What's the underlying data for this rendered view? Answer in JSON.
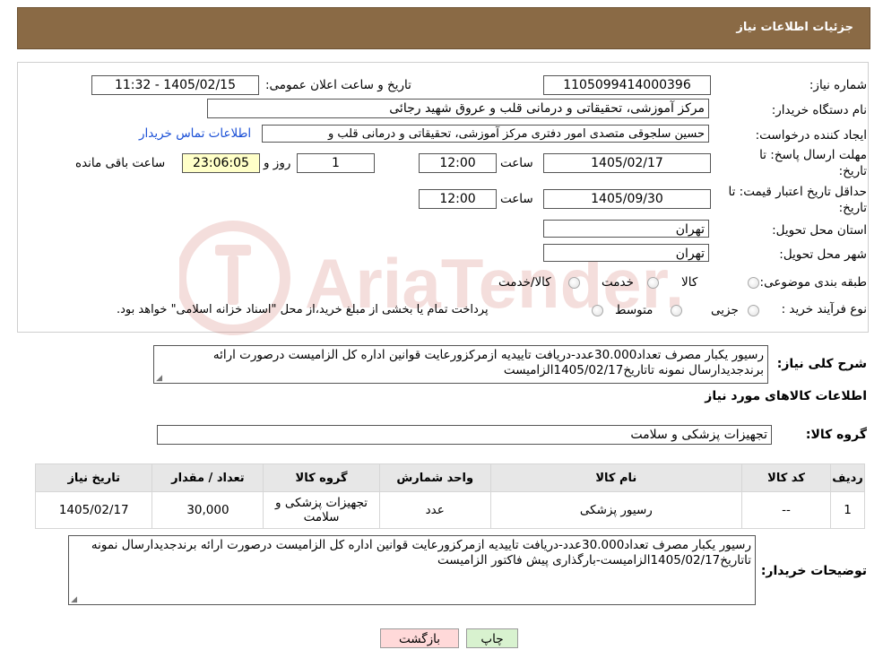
{
  "header": {
    "title": "جزئیات اطلاعات نیاز"
  },
  "form": {
    "need_number": {
      "label": "شماره نیاز:",
      "value": "1105099414000396"
    },
    "announce": {
      "label": "تاریخ و ساعت اعلان عمومی:",
      "value": "1405/02/15 - 11:32"
    },
    "buyer_org": {
      "label": "نام دستگاه خریدار:",
      "value": "مرکز آموزشی، تحقیقاتی و درمانی قلب و عروق شهید رجائی"
    },
    "requester": {
      "label": "ایجاد کننده درخواست:",
      "value": "حسین سلجوقی متصدی امور دفتری مرکز آموزشی، تحقیقاتی و درمانی قلب و"
    },
    "contact_link": "اطلاعات تماس خریدار",
    "deadline": {
      "label_line1": "مهلت ارسال پاسخ: تا",
      "label_line2": "تاریخ:",
      "date": "1405/02/17",
      "time_label": "ساعت",
      "time": "12:00",
      "days": "1",
      "days_label": "روز و",
      "remaining": "23:06:05",
      "remaining_label": "ساعت باقی مانده"
    },
    "validity": {
      "label_line1": "حداقل تاریخ اعتبار قیمت: تا",
      "label_line2": "تاریخ:",
      "date": "1405/09/30",
      "time_label": "ساعت",
      "time": "12:00"
    },
    "province": {
      "label": "استان محل تحویل:",
      "value": "تهران"
    },
    "city": {
      "label": "شهر محل تحویل:",
      "value": "تهران"
    },
    "category": {
      "label": "طبقه بندی موضوعی:",
      "options": [
        "کالا",
        "خدمت",
        "کالا/خدمت"
      ]
    },
    "process": {
      "label": "نوع فرآیند خرید :",
      "options": [
        "جزیی",
        "متوسط"
      ],
      "note": "پرداخت تمام یا بخشی از مبلغ خرید،از محل \"اسناد خزانه اسلامی\" خواهد بود."
    }
  },
  "watermark": {
    "text": "AriaTender.neT"
  },
  "summary": {
    "label": "شرح کلی نیاز:",
    "text": "رسیور یکبار مصرف تعداد30.000عدد-دریافت تاییدیه ازمرکزورعایت قوانین اداره کل الزامیست درصورت ارائه برندجدیدارسال نمونه تاتاریخ1405/02/17الزامیست"
  },
  "goods_section_title": "اطلاعات کالاهای مورد نیاز",
  "goods_group": {
    "label": "گروه کالا:",
    "value": "تجهیزات پزشکی و سلامت"
  },
  "table": {
    "headers": [
      "ردیف",
      "کد کالا",
      "نام کالا",
      "واحد شمارش",
      "گروه کالا",
      "تعداد / مقدار",
      "تاریخ نیاز"
    ],
    "rows": [
      [
        "1",
        "--",
        "رسیور پزشکی",
        "عدد",
        "تجهیزات پزشکی و سلامت",
        "30,000",
        "1405/02/17"
      ]
    ]
  },
  "buyer_notes": {
    "label": "توضیحات خریدار:",
    "text": "رسیور یکبار مصرف تعداد30.000عدد-دریافت تاییدیه ازمرکزورعایت قوانین اداره کل الزامیست درصورت ارائه برندجدیدارسال نمونه تاتاریخ1405/02/17الزامیست-بارگذاری پیش فاکتور الزامیست"
  },
  "buttons": {
    "print": "چاپ",
    "back": "بازگشت"
  },
  "colors": {
    "header_bg": "#8a6a45",
    "print_bg": "#d8f2cf",
    "back_bg": "#ffd9d9",
    "link": "#1a4fd6",
    "countdown_bg": "#ffffc8"
  }
}
